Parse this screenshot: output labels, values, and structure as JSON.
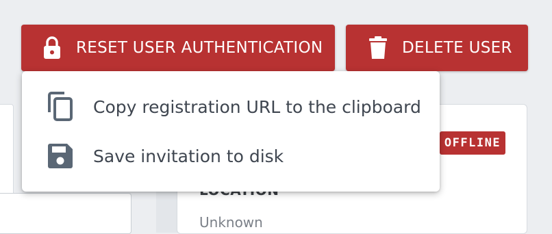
{
  "toolbar": {
    "reset_label": "RESET USER AUTHENTICATION",
    "reset_icon": "lock-icon",
    "delete_label": "DELETE USER",
    "delete_icon": "trash-icon",
    "button_color": "#b83232"
  },
  "menu": {
    "items": [
      {
        "label": "Copy registration URL to the clipboard",
        "icon": "copy-icon"
      },
      {
        "label": "Save invitation to disk",
        "icon": "floppy-disk-icon"
      }
    ],
    "icon_color": "#5a6775"
  },
  "user_card": {
    "status_badge": "OFFLINE",
    "status_color": "#b83232",
    "location_label": "LOCATION",
    "location_value": "Unknown"
  }
}
